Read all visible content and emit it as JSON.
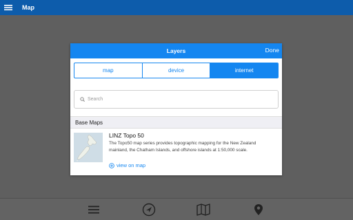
{
  "app_bar": {
    "title": "Map",
    "menu_icon": "hamburger-menu-icon"
  },
  "dialog": {
    "title": "Layers",
    "done_label": "Done",
    "segments": [
      {
        "label": "map",
        "active": false
      },
      {
        "label": "device",
        "active": false
      },
      {
        "label": "internet",
        "active": true
      }
    ],
    "search": {
      "placeholder": "Search",
      "icon": "search-icon"
    },
    "section": {
      "label": "Base Maps"
    },
    "layers": [
      {
        "name": "LINZ Topo 50",
        "description": "The Topo50 map series provides topographic mapping for the New Zealand mainland, the Chatham Islands, and offshore islands at 1:50,000 scale.",
        "link_label": "view on map",
        "thumbnail_icon": "new-zealand-map-thumbnail"
      }
    ]
  },
  "bottom_bar": {
    "buttons": [
      {
        "icon": "list-icon"
      },
      {
        "icon": "navigation-arrow-icon"
      },
      {
        "icon": "folded-map-icon"
      },
      {
        "icon": "location-pin-icon"
      }
    ]
  },
  "colors": {
    "app_bar": "#0d5cab",
    "accent": "#1486f0",
    "overlay": "#5f5f5f"
  }
}
